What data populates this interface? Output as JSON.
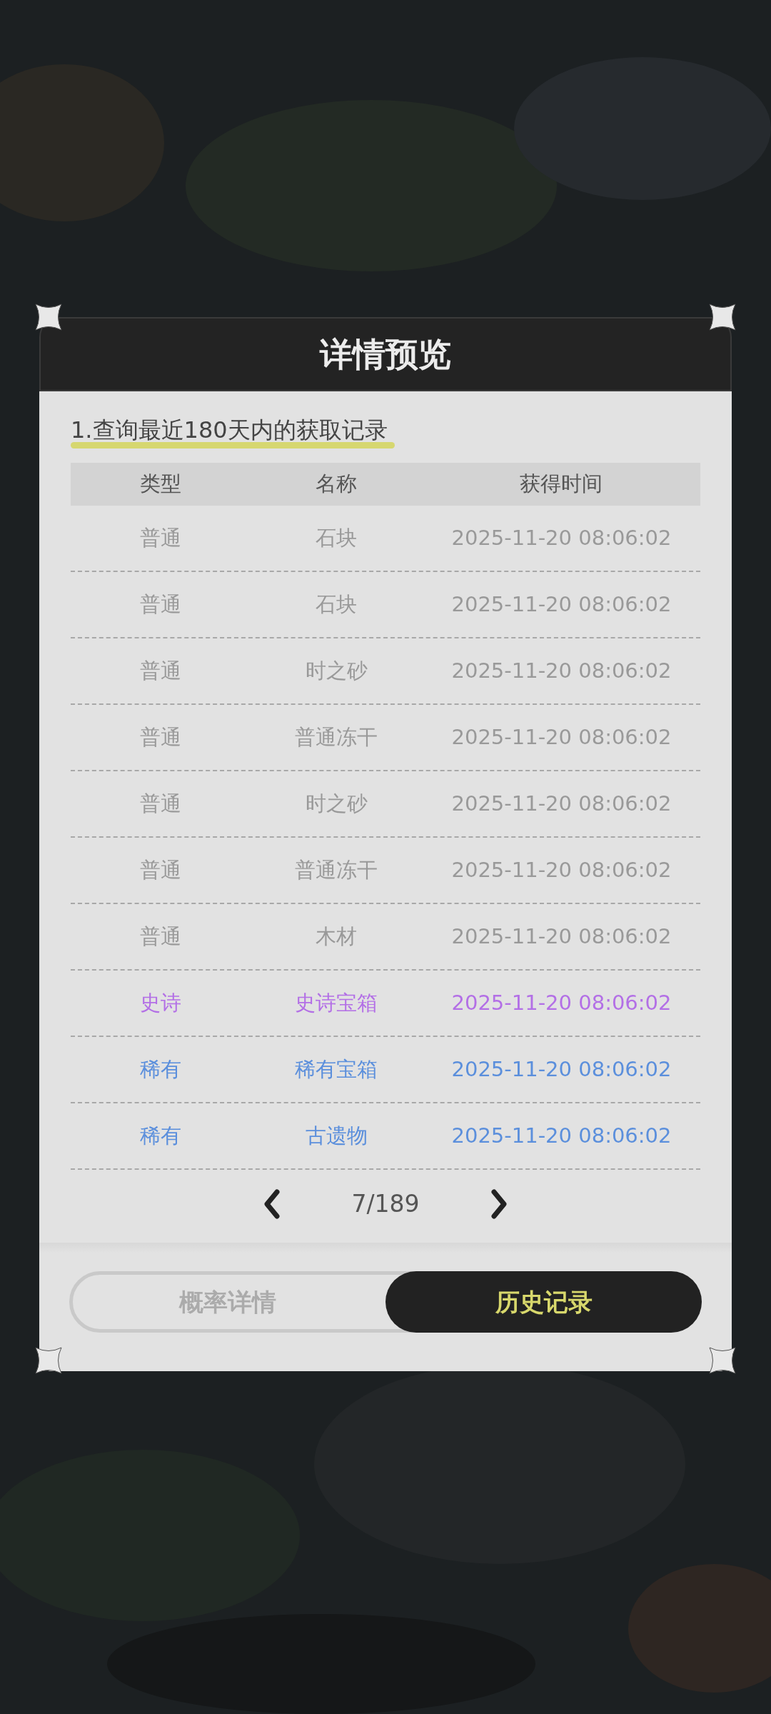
{
  "dialog": {
    "title": "详情预览"
  },
  "subtitle": "1.查询最近180天内的获取记录",
  "table": {
    "columns": [
      "类型",
      "名称",
      "获得时间"
    ],
    "rows": [
      {
        "type": "普通",
        "name": "石块",
        "time": "2025-11-20 08:06:02",
        "color": "#999999"
      },
      {
        "type": "普通",
        "name": "石块",
        "time": "2025-11-20 08:06:02",
        "color": "#999999"
      },
      {
        "type": "普通",
        "name": "时之砂",
        "time": "2025-11-20 08:06:02",
        "color": "#999999"
      },
      {
        "type": "普通",
        "name": "普通冻干",
        "time": "2025-11-20 08:06:02",
        "color": "#999999"
      },
      {
        "type": "普通",
        "name": "时之砂",
        "time": "2025-11-20 08:06:02",
        "color": "#999999"
      },
      {
        "type": "普通",
        "name": "普通冻干",
        "time": "2025-11-20 08:06:02",
        "color": "#999999"
      },
      {
        "type": "普通",
        "name": "木材",
        "time": "2025-11-20 08:06:02",
        "color": "#999999"
      },
      {
        "type": "史诗",
        "name": "史诗宝箱",
        "time": "2025-11-20 08:06:02",
        "color": "#b36fe6"
      },
      {
        "type": "稀有",
        "name": "稀有宝箱",
        "time": "2025-11-20 08:06:02",
        "color": "#5b8fdc"
      },
      {
        "type": "稀有",
        "name": "古遗物",
        "time": "2025-11-20 08:06:02",
        "color": "#5b8fdc"
      }
    ]
  },
  "pagination": {
    "page": "7/189"
  },
  "tabs": [
    {
      "label": "概率详情",
      "selected": false
    },
    {
      "label": "历史记录",
      "selected": true
    }
  ]
}
